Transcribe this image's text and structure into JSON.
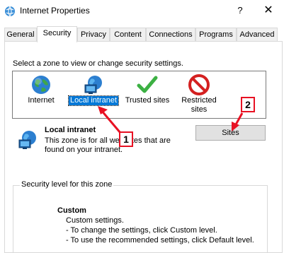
{
  "window": {
    "title": "Internet Properties",
    "help": "?",
    "close": "✕"
  },
  "tabs": [
    {
      "label": "General"
    },
    {
      "label": "Security"
    },
    {
      "label": "Privacy"
    },
    {
      "label": "Content"
    },
    {
      "label": "Connections"
    },
    {
      "label": "Programs"
    },
    {
      "label": "Advanced"
    }
  ],
  "active_tab": "Security",
  "zone_prompt": "Select a zone to view or change security settings.",
  "zones": [
    {
      "label": "Internet",
      "icon": "globe-icon"
    },
    {
      "label": "Local intranet",
      "icon": "intranet-icon",
      "selected": true
    },
    {
      "label": "Trusted sites",
      "icon": "checkmark-icon"
    },
    {
      "label_line1": "Restricted",
      "label_line2": "sites",
      "icon": "restricted-icon"
    }
  ],
  "detail": {
    "title": "Local intranet",
    "desc_line1": "This zone is for all web sites that are",
    "desc_line2": "found on your intranet."
  },
  "sites_button": "Sites",
  "security_group": {
    "legend": "Security level for this zone",
    "level": "Custom",
    "line1": "Custom settings.",
    "line2": "- To change the settings, click Custom level.",
    "line3": "- To use the recommended settings, click Default level."
  },
  "annotations": {
    "one": "1",
    "two": "2"
  },
  "colors": {
    "selection": "#0078d7",
    "annotation": "#e81123",
    "check": "#3cb043",
    "restricted": "#d42020"
  }
}
